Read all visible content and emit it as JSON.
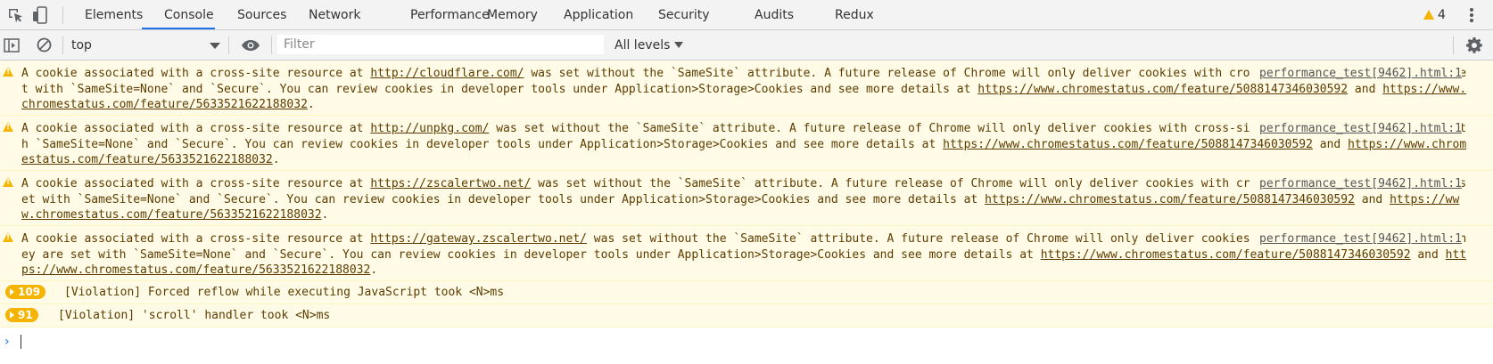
{
  "tabs": [
    {
      "label": "Elements"
    },
    {
      "label": "Console"
    },
    {
      "label": "Sources"
    },
    {
      "label": "Network"
    },
    {
      "label": "Performance"
    },
    {
      "label": "Memory"
    },
    {
      "label": "Application"
    },
    {
      "label": "Security"
    },
    {
      "label": "Audits"
    },
    {
      "label": "Redux"
    }
  ],
  "active_tab": "Console",
  "warning_count": "4",
  "toolbar": {
    "context": "top",
    "filter_placeholder": "Filter",
    "levels": "All levels"
  },
  "messages": [
    {
      "source": "performance_test[9462].html:1",
      "p1": "A cookie associated with a cross-site resource at ",
      "url": "http://cloudflare.com/",
      "p2": " was set without the `SameSite` attribute. A future release of Chrome will only deliver cookies with cross-site requests if they are set with `SameSite=None` and `Secure`. You can review cookies in developer tools under Application>Storage>Cookies and see more details at ",
      "link1": "https://www.chromestatus.com/feature/5088147346030592",
      "p3": " and ",
      "link2": "https://www.chromestatus.com/feature/5633521622188032",
      "p4": "."
    },
    {
      "source": "performance_test[9462].html:1",
      "p1": "A cookie associated with a cross-site resource at ",
      "url": "http://unpkg.com/",
      "p2": " was set without the `SameSite` attribute. A future release of Chrome will only deliver cookies with cross-site requests if they are set with `SameSite=None` and `Secure`. You can review cookies in developer tools under Application>Storage>Cookies and see more details at ",
      "link1": "https://www.chromestatus.com/feature/5088147346030592",
      "p3": " and ",
      "link2": "https://www.chromestatus.com/feature/5633521622188032",
      "p4": "."
    },
    {
      "source": "performance_test[9462].html:1",
      "p1": "A cookie associated with a cross-site resource at ",
      "url": "https://zscalertwo.net/",
      "p2": " was set without the `SameSite` attribute. A future release of Chrome will only deliver cookies with cross-site requests if they are set with `SameSite=None` and `Secure`. You can review cookies in developer tools under Application>Storage>Cookies and see more details at ",
      "link1": "https://www.chromestatus.com/feature/5088147346030592",
      "p3": " and ",
      "link2": "https://www.chromestatus.com/feature/5633521622188032",
      "p4": "."
    },
    {
      "source": "performance_test[9462].html:1",
      "p1": "A cookie associated with a cross-site resource at ",
      "url": "https://gateway.zscalertwo.net/",
      "p2": " was set without the `SameSite` attribute. A future release of Chrome will only deliver cookies with cross-site requests if they are set with `SameSite=None` and `Secure`. You can review cookies in developer tools under Application>Storage>Cookies and see more details at ",
      "link1": "https://www.chromestatus.com/feature/5088147346030592",
      "p3": " and ",
      "link2": "https://www.chromestatus.com/feature/5633521622188032",
      "p4": "."
    }
  ],
  "violations": [
    {
      "count": "109",
      "text": "[Violation] Forced reflow while executing JavaScript took <N>ms"
    },
    {
      "count": "91",
      "text": "[Violation] 'scroll' handler took <N>ms"
    }
  ],
  "colors": {
    "accent": "#1a73e8",
    "warning": "#f4b400",
    "warning_bg": "#fffbe6",
    "warning_text": "#5c3c00"
  }
}
